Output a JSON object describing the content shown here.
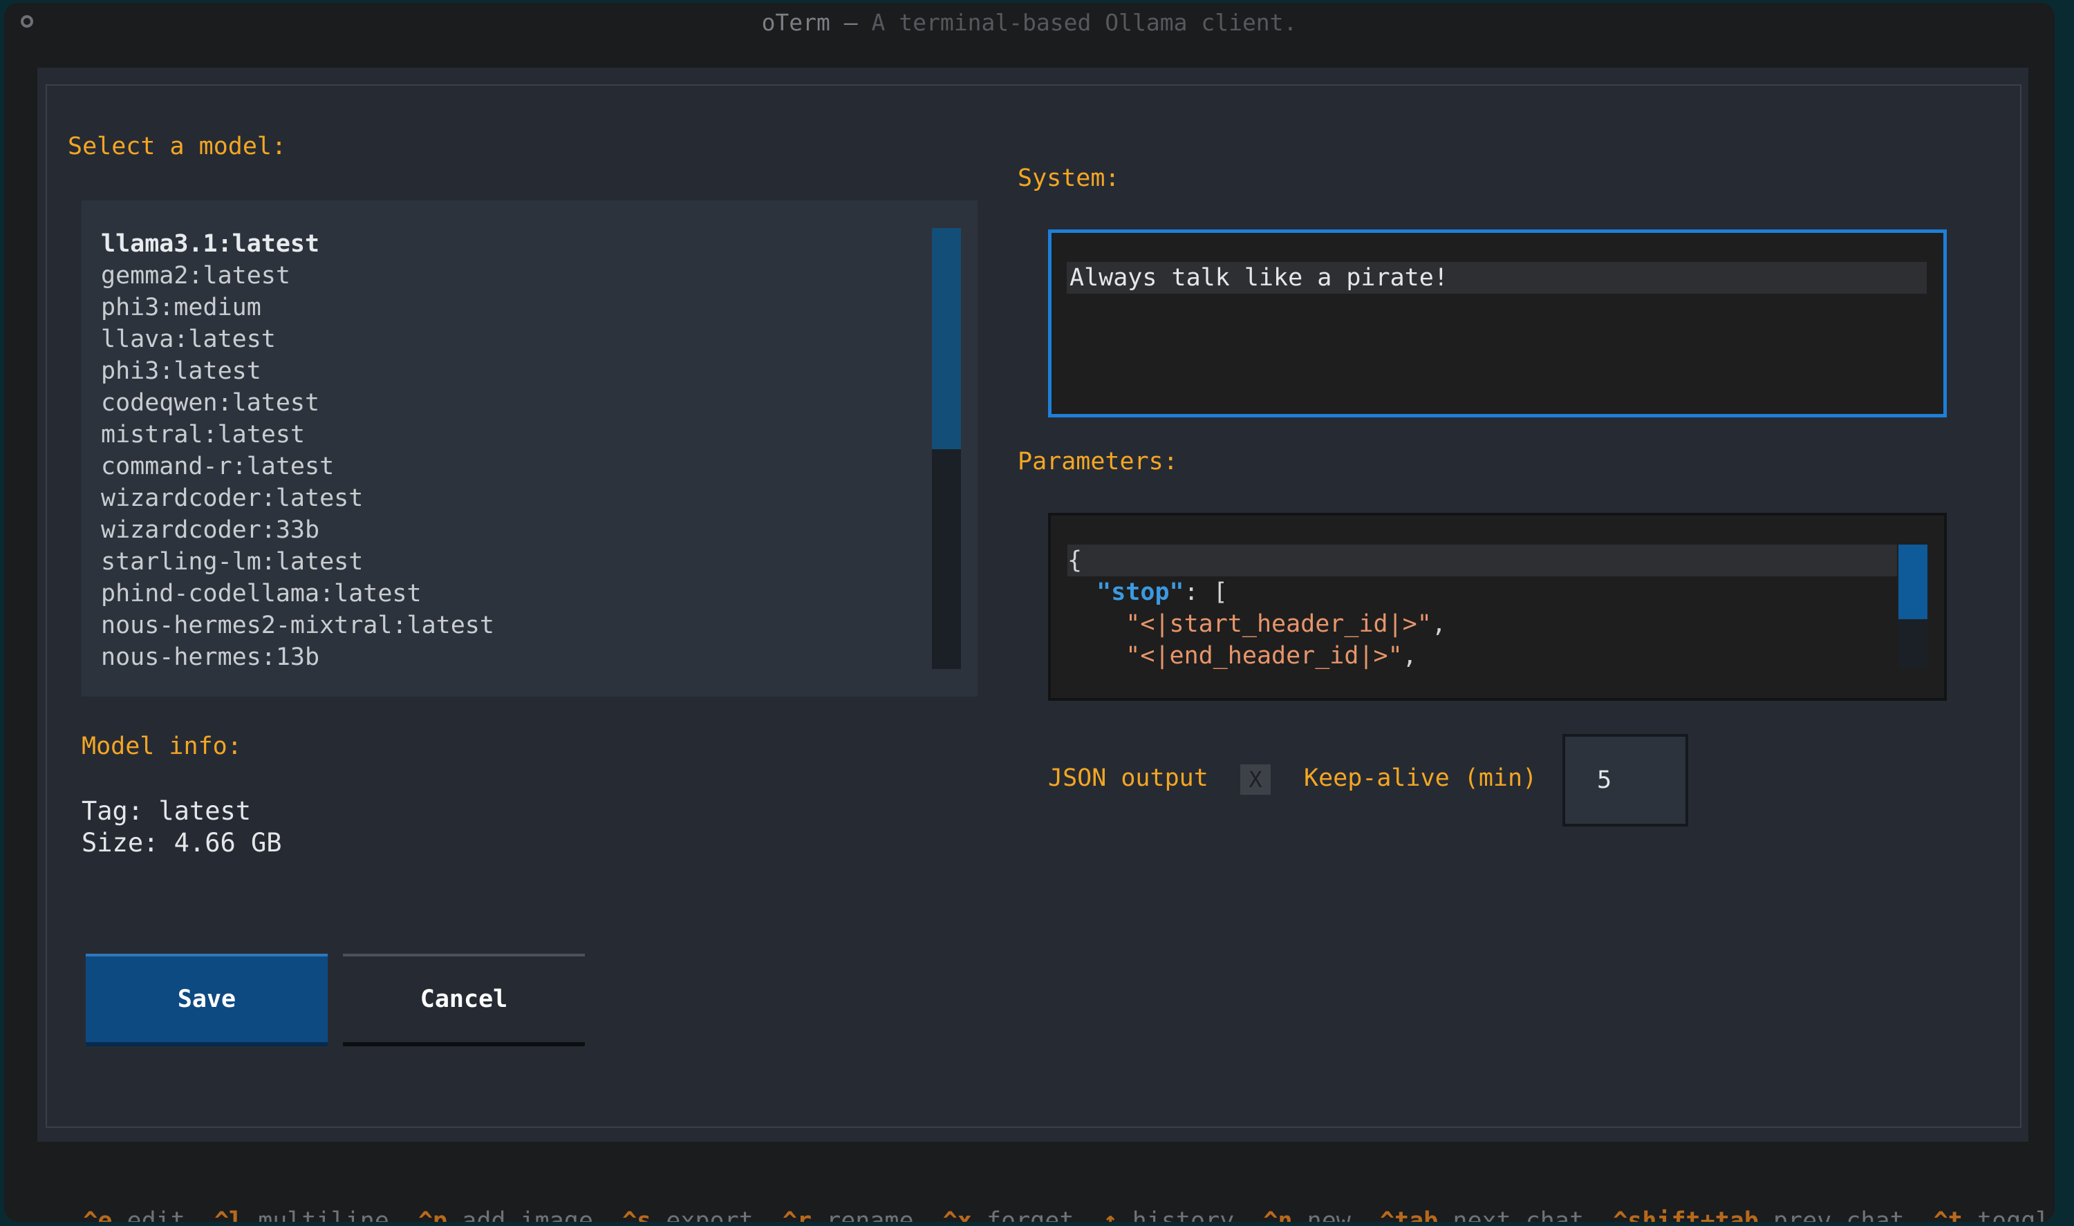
{
  "window": {
    "title_app": "oTerm",
    "title_sep": " — ",
    "title_desc": "A terminal-based Ollama client."
  },
  "left": {
    "select_label": "Select a model:",
    "models": [
      "llama3.1:latest",
      "gemma2:latest",
      "phi3:medium",
      "llava:latest",
      "phi3:latest",
      "codeqwen:latest",
      "mistral:latest",
      "command-r:latest",
      "wizardcoder:latest",
      "wizardcoder:33b",
      "starling-lm:latest",
      "phind-codellama:latest",
      "nous-hermes2-mixtral:latest",
      "nous-hermes:13b"
    ],
    "selected_model": "llama3.1:latest",
    "info_label": "Model info:",
    "tag_line": "Tag: latest",
    "size_line": "Size: 4.66 GB"
  },
  "buttons": {
    "save": "Save",
    "cancel": "Cancel"
  },
  "right": {
    "system_label": "System:",
    "system_value": "Always talk like a pirate!",
    "params_label": "Parameters:",
    "params_lines": {
      "l1": "{",
      "l2_indent": "  ",
      "l2_key": "\"stop\"",
      "l2_rest": ": [",
      "l3_indent": "    ",
      "l3_str": "\"<|start_header_id|>\"",
      "l3_rest": ",",
      "l4_indent": "    ",
      "l4_str": "\"<|end_header_id|>\"",
      "l4_rest": ","
    },
    "json_output_label": "JSON output",
    "json_output_checkbox": "X",
    "keepalive_label": "Keep-alive (min)",
    "keepalive_value": "5"
  },
  "footer": [
    {
      "key": "^e",
      "label": "edit"
    },
    {
      "key": "^l",
      "label": "multiline"
    },
    {
      "key": "^p",
      "label": "add image"
    },
    {
      "key": "^s",
      "label": "export"
    },
    {
      "key": "^r",
      "label": "rename"
    },
    {
      "key": "^x",
      "label": "forget"
    },
    {
      "key": "↑",
      "label": "history"
    },
    {
      "key": "^n",
      "label": "new"
    },
    {
      "key": "^tab",
      "label": "next chat"
    },
    {
      "key": "^shift+tab",
      "label": "prev chat"
    },
    {
      "key": "^t",
      "label": "toggl"
    }
  ],
  "colors": {
    "accent": "#f5a623",
    "focus_border": "#1e7fd8",
    "primary_button": "#0e4a82",
    "footer_key": "#b8691c"
  }
}
